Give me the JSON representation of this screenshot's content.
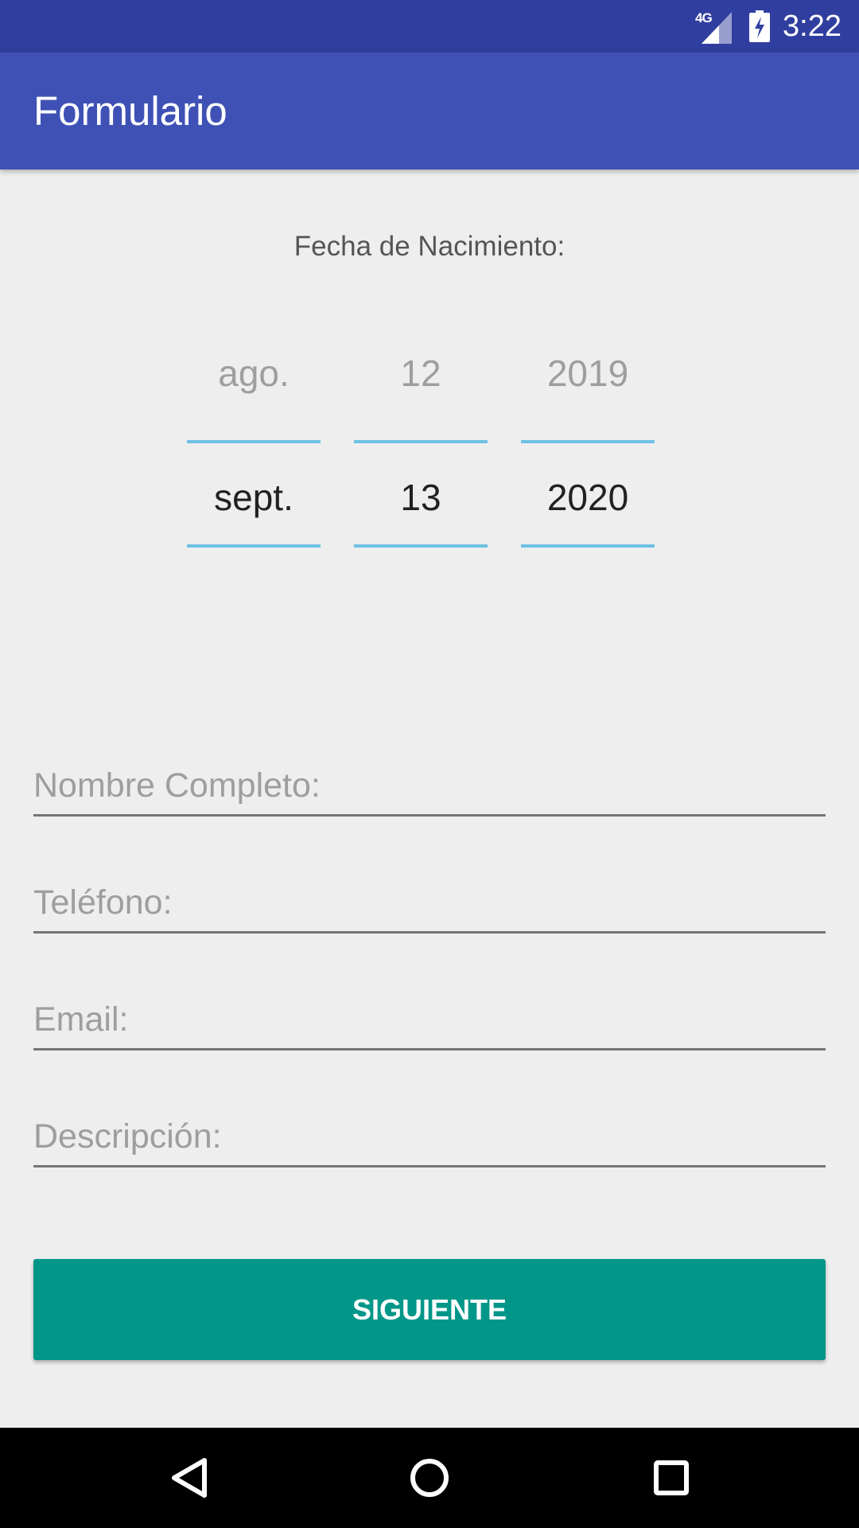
{
  "status_bar": {
    "network_label": "4G",
    "time": "3:22",
    "icons": [
      "signal-icon",
      "battery-charging-icon"
    ]
  },
  "app_bar": {
    "title": "Formulario"
  },
  "birth_date": {
    "label": "Fecha de Nacimiento:",
    "month": {
      "previous": "ago.",
      "selected": "sept."
    },
    "day": {
      "previous": "12",
      "selected": "13"
    },
    "year": {
      "previous": "2019",
      "selected": "2020"
    }
  },
  "form": {
    "full_name_placeholder": "Nombre Completo:",
    "phone_placeholder": "Teléfono:",
    "email_placeholder": "Email:",
    "description_placeholder": "Descripción:"
  },
  "next_button": {
    "label": "SIGUIENTE"
  },
  "nav_bar": {
    "icons": [
      "back-icon",
      "home-icon",
      "recents-icon"
    ]
  },
  "colors": {
    "status_bar": "#303f9f",
    "app_bar": "#3f51b5",
    "accent_button": "#009688",
    "picker_divider": "#6ec1e4",
    "background": "#eeeeee"
  }
}
